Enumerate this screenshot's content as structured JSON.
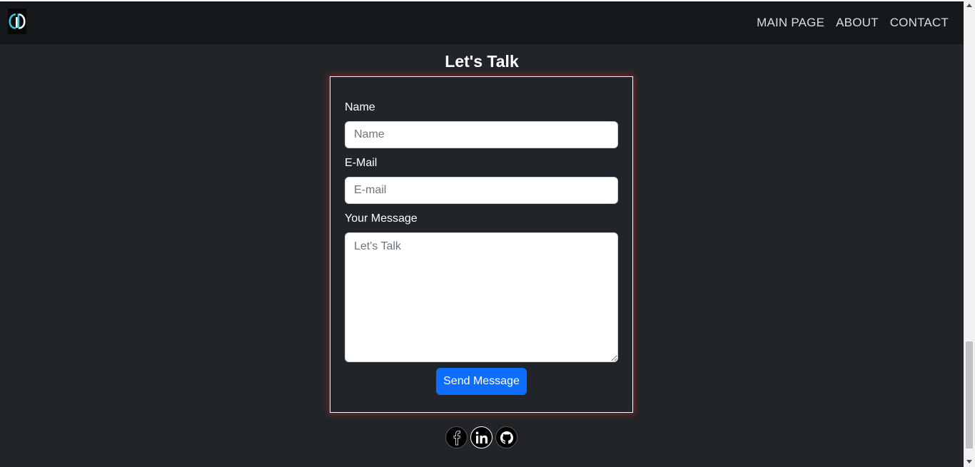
{
  "navbar": {
    "logo_icon": "brand-logo-icon",
    "links": [
      {
        "label": "MAIN PAGE"
      },
      {
        "label": "ABOUT"
      },
      {
        "label": "CONTACT"
      }
    ]
  },
  "page": {
    "title": "Let's Talk"
  },
  "form": {
    "name_label": "Name",
    "name_placeholder": "Name",
    "name_value": "",
    "email_label": "E-Mail",
    "email_placeholder": "E-mail",
    "email_value": "",
    "message_label": "Your Message",
    "message_placeholder": "Let's Talk",
    "message_value": "",
    "submit_label": "Send Message"
  },
  "socials": [
    {
      "icon": "facebook-icon"
    },
    {
      "icon": "linkedin-icon"
    },
    {
      "icon": "github-icon"
    }
  ],
  "colors": {
    "background": "#212529",
    "navbar": "#16191c",
    "primary_button": "#0d6efd",
    "card_glow": "#c82828"
  }
}
